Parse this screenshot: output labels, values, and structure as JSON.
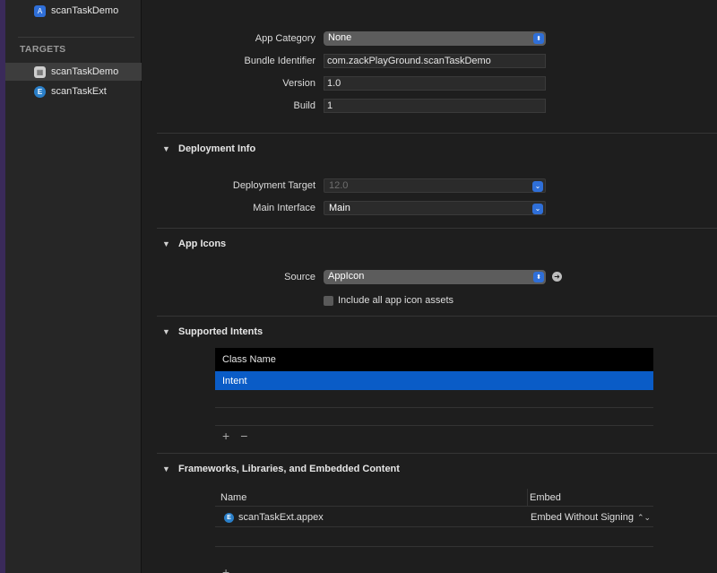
{
  "sidebar": {
    "project": "scanTaskDemo",
    "targets_header": "TARGETS",
    "targets": [
      {
        "label": "scanTaskDemo",
        "icon": "app-target-icon",
        "selected": true
      },
      {
        "label": "scanTaskExt",
        "icon": "extension-icon",
        "selected": false
      }
    ]
  },
  "identity": {
    "app_category_label": "App Category",
    "app_category_value": "None",
    "bundle_id_label": "Bundle Identifier",
    "bundle_id_value": "com.zackPlayGround.scanTaskDemo",
    "version_label": "Version",
    "version_value": "1.0",
    "build_label": "Build",
    "build_value": "1"
  },
  "deployment": {
    "title": "Deployment Info",
    "target_label": "Deployment Target",
    "target_value": "12.0",
    "main_interface_label": "Main Interface",
    "main_interface_value": "Main"
  },
  "app_icons": {
    "title": "App Icons",
    "source_label": "Source",
    "source_value": "AppIcon",
    "include_all_label": "Include all app icon assets"
  },
  "intents": {
    "title": "Supported Intents",
    "column": "Class Name",
    "rows": [
      "Intent"
    ],
    "add": "+",
    "remove": "−"
  },
  "frameworks": {
    "title": "Frameworks, Libraries, and Embedded Content",
    "col_name": "Name",
    "col_embed": "Embed",
    "rows": [
      {
        "name": "scanTaskExt.appex",
        "embed": "Embed Without Signing"
      }
    ],
    "add": "+"
  }
}
